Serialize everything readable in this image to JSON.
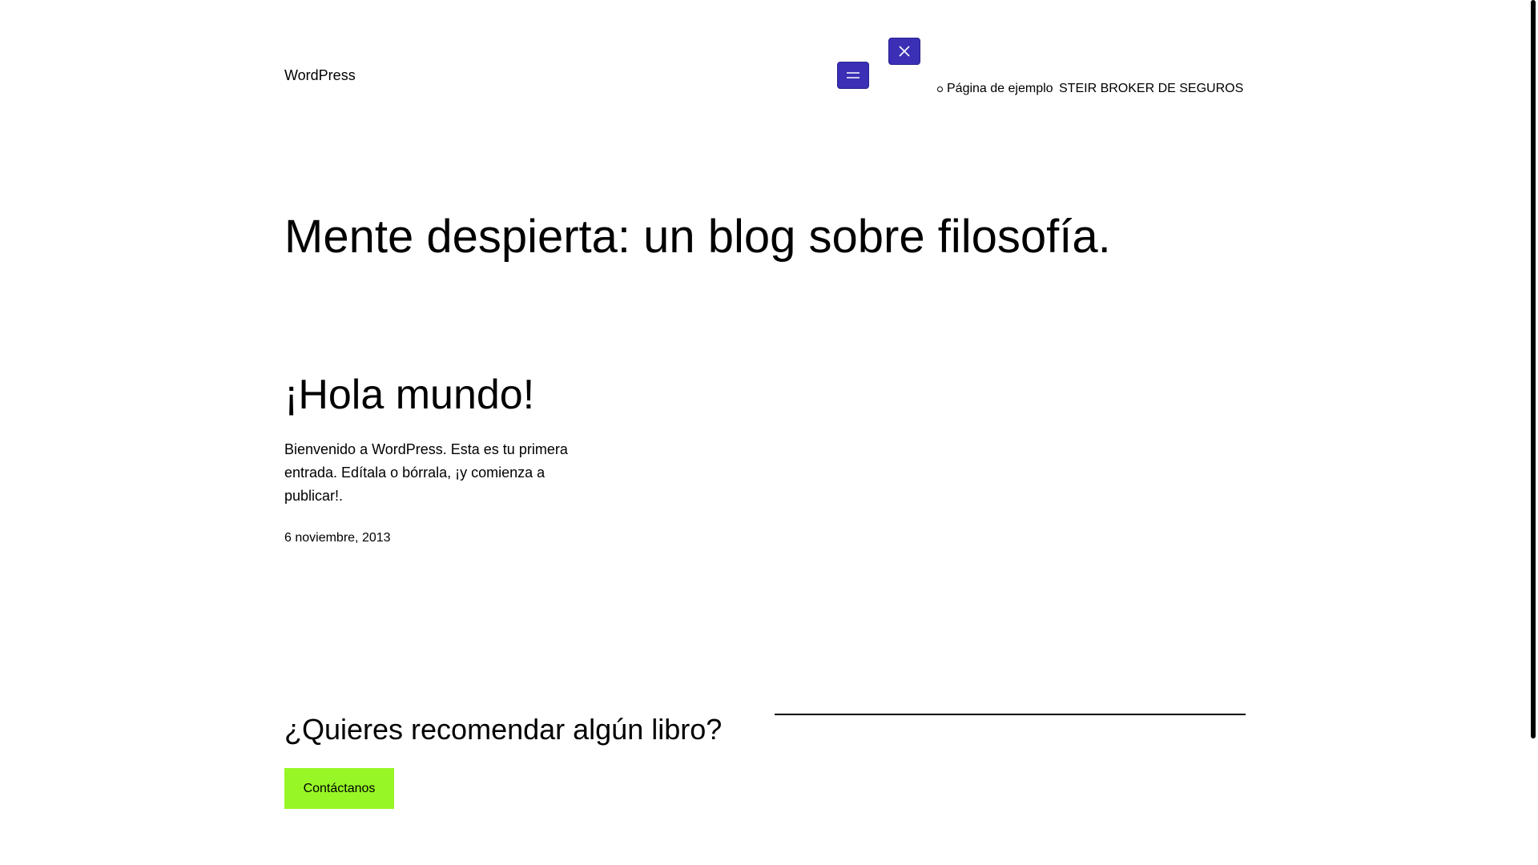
{
  "header": {
    "site_title": "WordPress",
    "menu_open_icon": "hamburger-icon",
    "menu_close_icon": "close-icon",
    "accent_color": "#3a2fb5",
    "nav": [
      {
        "label": "Página de ejemplo"
      },
      {
        "label": "STEIR BROKER DE SEGUROS"
      }
    ]
  },
  "hero": {
    "title": "Mente despierta: un blog sobre filosofía."
  },
  "post": {
    "title": "¡Hola mundo!",
    "excerpt": "Bienvenido a WordPress. Esta es tu primera entrada. Edítala o bórrala, ¡y comienza a publicar!.",
    "date": "6 noviembre, 2013"
  },
  "cta": {
    "heading": "¿Quieres recomendar algún libro?",
    "button_label": "Contáctanos",
    "button_color": "#97f726"
  }
}
